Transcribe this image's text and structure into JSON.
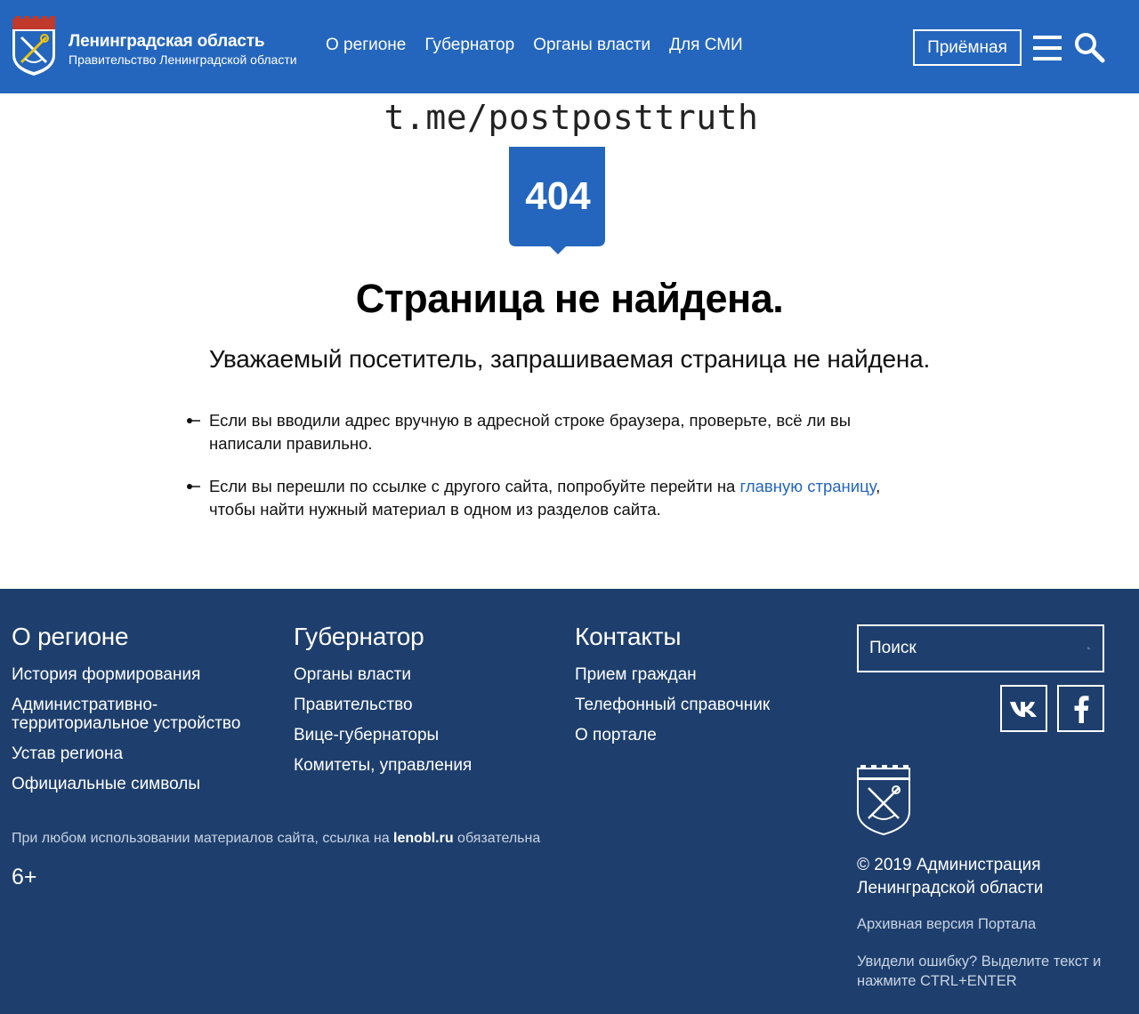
{
  "header": {
    "brand_title": "Ленинградская область",
    "brand_subtitle": "Правительство Ленинградской области",
    "nav": [
      "О регионе",
      "Губернатор",
      "Органы власти",
      "Для СМИ"
    ],
    "reception_label": "Приёмная",
    "icons": {
      "menu": "hamburger-menu-icon",
      "search": "search-icon",
      "logo": "coat-of-arms-emblem"
    },
    "colors": {
      "background": "#2466bd",
      "text": "#ffffff"
    }
  },
  "main": {
    "watermark": "t.me/postposttruth",
    "error_code": "404",
    "title": "Страница не найдена.",
    "subtitle": "Уважаемый посетитель, запрашиваемая страница не найдена.",
    "tips": [
      {
        "text": "Если вы вводили адрес вручную в адресной строке браузера, проверьте, всё ли вы написали правильно."
      },
      {
        "before": "Если вы перешли по ссылке с другого сайта, попробуйте перейти на ",
        "link": "главную страницу",
        "after": ", чтобы найти нужный материал в одном из разделов сайта."
      }
    ],
    "colors": {
      "shield": "#2466bd",
      "link": "#2466bd"
    }
  },
  "footer": {
    "columns": [
      {
        "title": "О регионе",
        "items": [
          "История формирования",
          "Административно-территориальное устройство",
          "Устав региона",
          "Официальные символы"
        ]
      },
      {
        "title": "Губернатор",
        "items": [
          "Органы власти",
          "Правительство",
          "Вице-губернаторы",
          "Комитеты, управления"
        ]
      },
      {
        "title": "Контакты",
        "items": [
          "Прием граждан",
          "Телефонный справочник",
          "О портале"
        ]
      }
    ],
    "note_before": "При любом использовании материалов сайта, ссылка на ",
    "note_site": "lenobl.ru",
    "note_after": " обязательна",
    "age": "6+",
    "search_placeholder": "Поиск",
    "social": {
      "vk": "vk-icon",
      "facebook": "facebook-icon"
    },
    "copyright": "© 2019 Администрация Ленинградской области",
    "archive": "Архивная версия Портала",
    "error_note": "Увидели ошибку? Выделите текст и нажмите CTRL+ENTER",
    "colors": {
      "background": "#1e3f6d",
      "muted": "#c8d3e2"
    }
  }
}
